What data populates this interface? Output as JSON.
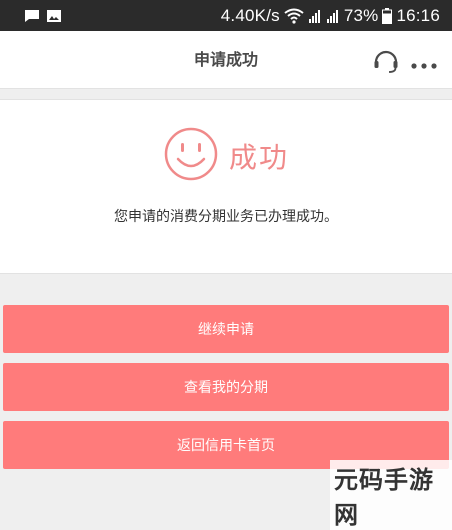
{
  "status_bar": {
    "network_speed": "4.40K/s",
    "battery": "73%",
    "time": "16:16",
    "icons": [
      "chat-icon",
      "image-icon",
      "wifi-icon",
      "signal-icon",
      "signal-icon",
      "battery-icon"
    ]
  },
  "header": {
    "title": "申请成功",
    "icons": [
      "headset-icon",
      "more-icon"
    ]
  },
  "success": {
    "icon": "smiley-icon",
    "label": "成功",
    "message": "您申请的消费分期业务已办理成功。"
  },
  "actions": {
    "continue_label": "继续申请",
    "my_installments_label": "查看我的分期",
    "back_label": "返回信用卡首页"
  },
  "watermark": "元码手游网",
  "colors": {
    "accent": "#ff7b7b",
    "success_text": "#f08a8a",
    "status_bar_bg": "#2b2b2b",
    "page_bg": "#efefef"
  }
}
